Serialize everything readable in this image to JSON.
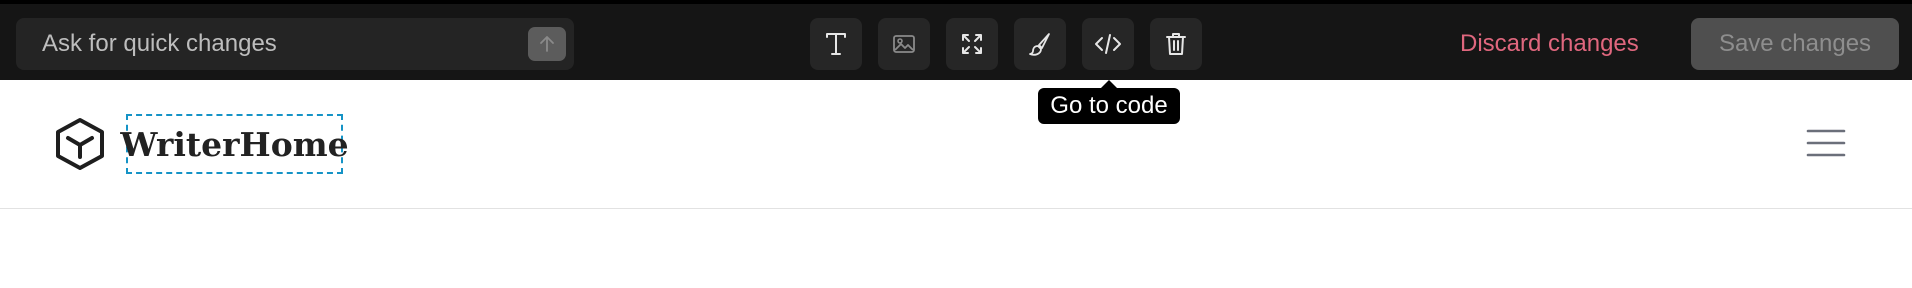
{
  "editor_toolbar": {
    "quick_changes_placeholder": "Ask for quick changes",
    "tools": [
      {
        "name": "text",
        "icon": "text-icon"
      },
      {
        "name": "image",
        "icon": "image-icon"
      },
      {
        "name": "resize",
        "icon": "expand-icon"
      },
      {
        "name": "style",
        "icon": "paintbrush-icon"
      },
      {
        "name": "code",
        "icon": "code-icon"
      },
      {
        "name": "delete",
        "icon": "trash-icon"
      }
    ],
    "discard_label": "Discard changes",
    "save_label": "Save changes",
    "tooltip_text": "Go to code",
    "colors": {
      "toolbar_bg": "#151515",
      "discard": "#e0677e",
      "save_bg": "#4f4f4f",
      "selection_outline": "#1593c6"
    }
  },
  "site": {
    "brand_name": "WriterHome",
    "logo_icon": "cube-icon",
    "menu_icon": "hamburger-icon"
  }
}
